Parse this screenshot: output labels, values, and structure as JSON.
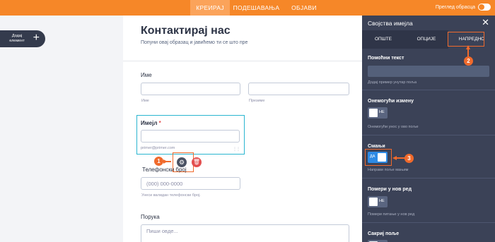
{
  "topbar": {
    "tabs": [
      "КРЕИРАЈ",
      "ПОДЕШАВАЊА",
      "ОБЈАВИ"
    ],
    "active_tab": "КРЕИРАЈ",
    "preview_label": "Преглед обрасца",
    "accent": "#f68728"
  },
  "add_element": {
    "label": "Додај елемент",
    "icon": "plus-icon"
  },
  "form": {
    "title": "Контактирај нас",
    "subtitle": "Попуни овај образац и јавићемо ти се што пре",
    "name": {
      "label": "Име",
      "first_sub": "Име",
      "last_sub": "Презиме"
    },
    "email": {
      "label": "Имејл",
      "required_mark": "*",
      "sublabel": "primer@primer.com"
    },
    "phone": {
      "label": "Телефонски број",
      "placeholder": "(000) 000-0000",
      "sublabel": "Унеси валидан телефонски број."
    },
    "message": {
      "label": "Порука",
      "placeholder": "Пиши овде..."
    }
  },
  "panel": {
    "title": "Својства имејла",
    "tabs": [
      "ОПШТЕ",
      "ОПЦИЈЕ",
      "НАПРЕДНО"
    ],
    "active_tab": "НАПРЕДНО",
    "hint_text": {
      "title": "Помоћни текст",
      "desc": "Додај пример унутар поља"
    },
    "disable_edit": {
      "title": "Онемогући измену",
      "toggle": "НЕ",
      "desc": "Онемогући унос у ово поље"
    },
    "shrink": {
      "title": "Смањи",
      "toggle": "ДА",
      "desc": "Направи поље мањим"
    },
    "new_row": {
      "title": "Помери у нов ред",
      "toggle": "НЕ",
      "desc": "Помери питање у нов ред"
    },
    "hide": {
      "title": "Сакриј поље"
    }
  },
  "callouts": [
    "1",
    "2",
    "3"
  ],
  "colors": {
    "highlight": "#f06a2c",
    "selection": "#2ab5d0",
    "toggle_on": "#2d8ae4",
    "delete": "#e34f4f"
  }
}
